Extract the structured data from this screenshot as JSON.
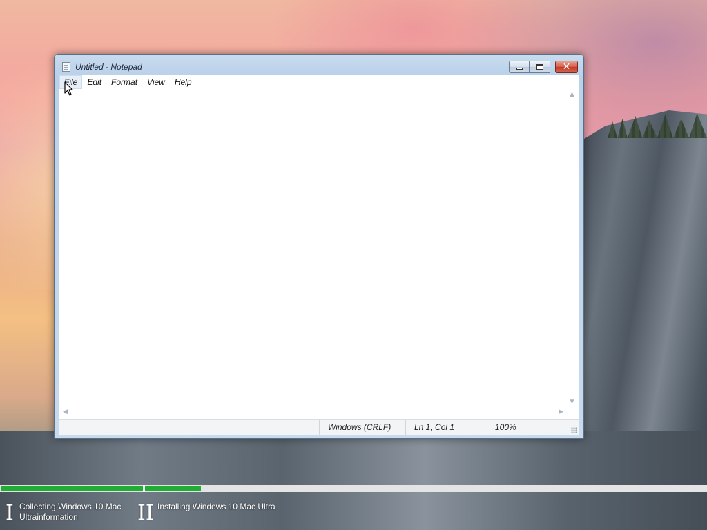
{
  "window": {
    "title": "Untitled - Notepad",
    "menu": [
      "File",
      "Edit",
      "Format",
      "View",
      "Help"
    ],
    "active_menu": "File",
    "text_content": "",
    "status": {
      "line_ending": "Windows (CRLF)",
      "position": "Ln 1, Col 1",
      "zoom": "100%"
    }
  },
  "installer": {
    "steps": [
      {
        "numeral": "I",
        "label": "Collecting Windows 10 Mac Ultrainformation",
        "progress": 1.0
      },
      {
        "numeral": "II",
        "label": "Installing Windows 10 Mac Ultra",
        "progress": 0.1
      }
    ],
    "progress_color": "#1fae33"
  },
  "colors": {
    "close_button": "#c33a26",
    "window_frame": "#b9d1ea"
  },
  "icons": {
    "app": "notepad-icon",
    "minimize": "minimize-icon",
    "maximize": "maximize-icon",
    "close": "close-icon",
    "cursor": "mouse-pointer-icon"
  }
}
